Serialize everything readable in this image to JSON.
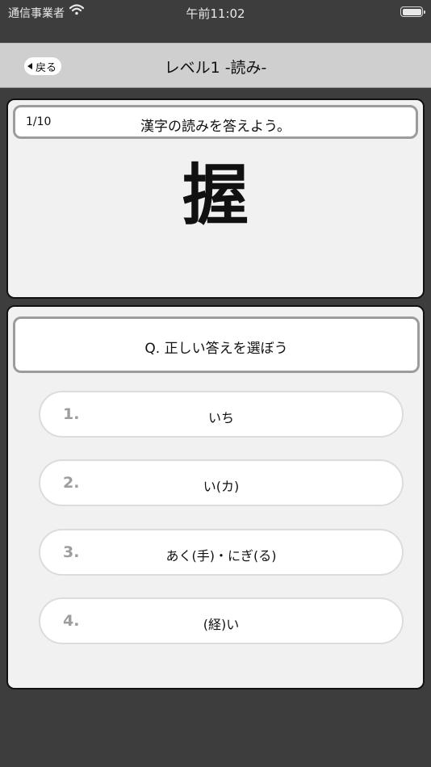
{
  "status_bar": {
    "carrier": "通信事業者",
    "time": "午前11:02",
    "wifi_icon": "wifi-icon",
    "battery_icon": "battery-icon"
  },
  "nav": {
    "back_label": "戻る",
    "title": "レベル1 -読み-"
  },
  "question": {
    "counter": "1/10",
    "instruction": "漢字の読みを答えよう。",
    "kanji": "握"
  },
  "answers": {
    "prompt": "Q. 正しい答えを選ぼう",
    "choices": [
      {
        "number": "1.",
        "label": "いち"
      },
      {
        "number": "2.",
        "label": "い(カ)"
      },
      {
        "number": "3.",
        "label": "あく(手)・にぎ(る)"
      },
      {
        "number": "4.",
        "label": "(経)い"
      }
    ]
  },
  "colors": {
    "background": "#3d3d3d",
    "nav_bar": "#cfcfcf",
    "card": "#f1f1f1",
    "choice_number": "#9d9d9d"
  }
}
